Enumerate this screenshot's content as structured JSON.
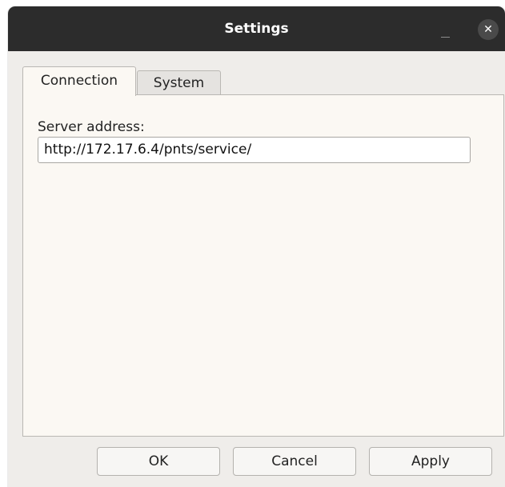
{
  "window": {
    "title": "Settings",
    "close_glyph": "✕"
  },
  "tabs": [
    {
      "label": "Connection",
      "selected": true
    },
    {
      "label": "System",
      "selected": false
    }
  ],
  "connection": {
    "server_label": "Server address:",
    "server_value": "http://172.17.6.4/pnts/service/"
  },
  "buttons": {
    "ok": "OK",
    "cancel": "Cancel",
    "apply": "Apply"
  },
  "colors": {
    "titlebar": "#2c2c2c",
    "panel": "#fbf8f3",
    "window_bg": "#efedea"
  }
}
